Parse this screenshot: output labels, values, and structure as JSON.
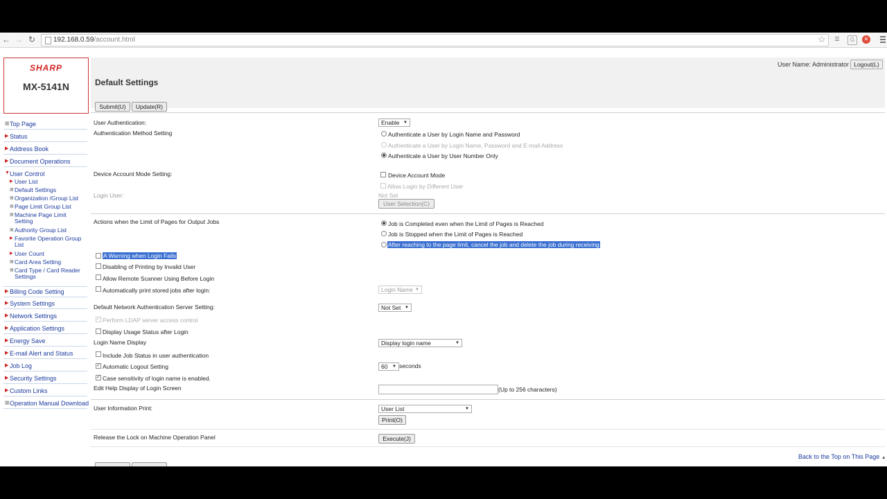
{
  "browser": {
    "url_host": "192.168.0.59",
    "url_path": "/account.html"
  },
  "logo": {
    "brand": "SHARP",
    "model": "MX-5141N"
  },
  "header": {
    "user_line": "User Name: Administrator",
    "logout_label": "Logout(L)",
    "title": "Default Settings"
  },
  "toolbar": {
    "submit_label": "Submit(U)",
    "update_label": "Update(R)"
  },
  "sidebar": {
    "items": [
      {
        "label": "Top Page"
      },
      {
        "label": "Status"
      },
      {
        "label": "Address Book"
      },
      {
        "label": "Document Operations"
      },
      {
        "label": "User Control"
      },
      {
        "label": "Billing Code Setting"
      },
      {
        "label": "System Settings"
      },
      {
        "label": "Network Settings"
      },
      {
        "label": "Application Settings"
      },
      {
        "label": "Energy Save"
      },
      {
        "label": "E-mail Alert and Status"
      },
      {
        "label": "Job Log"
      },
      {
        "label": "Security Settings"
      },
      {
        "label": "Custom Links"
      },
      {
        "label": "Operation Manual Download"
      }
    ],
    "user_control_sub": [
      {
        "label": "User List"
      },
      {
        "label": "Default Settings"
      },
      {
        "label": "Organization /Group List"
      },
      {
        "label": "Page Limit Group List"
      },
      {
        "label": "Machine Page Limit Setting"
      },
      {
        "label": "Authority Group List"
      },
      {
        "label": "Favorite Operation Group List"
      },
      {
        "label": "User Count"
      },
      {
        "label": "Card Area Setting"
      },
      {
        "label": "Card Type / Card Reader Settings"
      }
    ]
  },
  "form": {
    "user_auth_label": "User Authentication:",
    "user_auth_value": "Enable",
    "auth_method_label": "Authentication Method Setting",
    "auth_opt1": "Authenticate a User by Login Name and Password",
    "auth_opt2": "Authenticate a User by Login Name, Password and E-mail Address",
    "auth_opt3": "Authenticate a User by User Number Only",
    "device_account_label": "Device Account Mode Setting:",
    "device_account_mode": "Device Account Mode",
    "allow_login_diff": "Allow Login by Different User",
    "login_user_label": "Login User:",
    "login_user_value": "Not Set",
    "user_selection_label": "User Selection(C)",
    "limit_actions_label": "Actions when the Limit of Pages for Output Jobs",
    "limit_opt1": "Job is Completed even when the Limit of Pages is Reached",
    "limit_opt2": "Job is Stopped when the Limit of Pages is Reached",
    "limit_opt3": "After reaching to the page limit, cancel the job and delete the job during receiving",
    "warning_login_fails": "A Warning when Login Fails",
    "disable_invalid_user": "Disabling of Printing by Invalid User",
    "allow_remote_scanner": "Allow Remote Scanner Using Before Login",
    "auto_print_stored": "Automatically print stored jobs after login:",
    "auto_print_select": "Login Name",
    "network_auth_label": "Default Network Authentication Server Setting:",
    "network_auth_value": "Not Set",
    "ldap_access": "Perform LDAP server access control",
    "display_usage": "Display Usage Status after Login",
    "login_name_display_label": "Login Name Display",
    "login_name_display_value": "Display login name",
    "include_job_status": "Include Job Status in user authentication",
    "auto_logout": "Automatic Logout Setting",
    "auto_logout_value": "60",
    "seconds_label": "seconds",
    "case_sensitivity": "Case sensitivity of login name is enabled.",
    "edit_help_label": "Edit Help Display of Login Screen",
    "edit_help_hint": "(Up to 256 characters)",
    "user_info_print_label": "User Information Print:",
    "user_info_print_value": "User List",
    "print_label": "Print(O)",
    "release_lock_label": "Release the Lock on Machine Operation Panel",
    "execute_label": "Execute(J)",
    "back_to_top": "Back to the Top on This Page"
  }
}
